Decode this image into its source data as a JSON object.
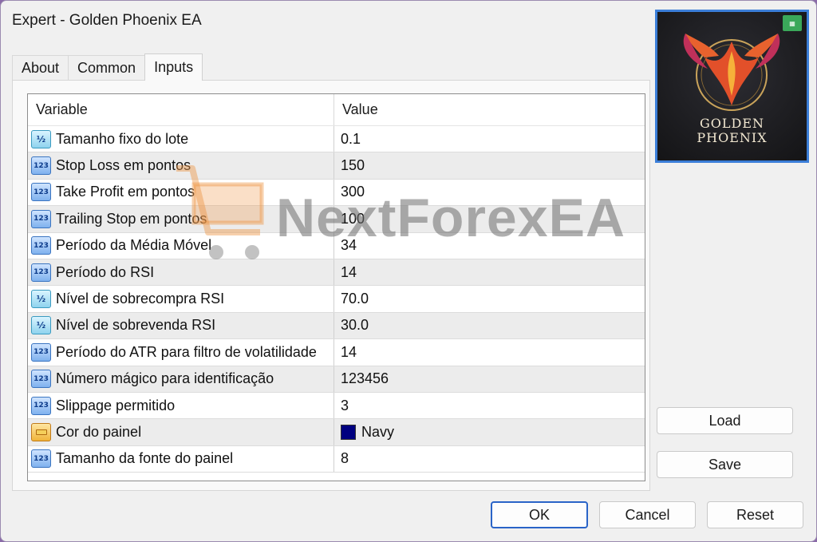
{
  "window": {
    "title": "Expert - Golden Phoenix EA"
  },
  "tabs": [
    {
      "label": "About"
    },
    {
      "label": "Common"
    },
    {
      "label": "Inputs"
    }
  ],
  "table": {
    "columns": [
      "Variable",
      "Value"
    ],
    "rows": [
      {
        "icon": "double-type-icon",
        "variable": "Tamanho fixo do lote",
        "value": "0.1"
      },
      {
        "icon": "integer-type-icon",
        "variable": "Stop Loss em pontos",
        "value": "150"
      },
      {
        "icon": "integer-type-icon",
        "variable": "Take Profit em pontos",
        "value": "300"
      },
      {
        "icon": "integer-type-icon",
        "variable": "Trailing Stop em pontos",
        "value": "100"
      },
      {
        "icon": "integer-type-icon",
        "variable": "Período da Média Móvel",
        "value": "34"
      },
      {
        "icon": "integer-type-icon",
        "variable": "Período do RSI",
        "value": "14"
      },
      {
        "icon": "double-type-icon",
        "variable": "Nível de sobrecompra RSI",
        "value": "70.0"
      },
      {
        "icon": "double-type-icon",
        "variable": "Nível de sobrevenda RSI",
        "value": "30.0"
      },
      {
        "icon": "integer-type-icon",
        "variable": "Período do ATR para filtro de volatilidade",
        "value": "14"
      },
      {
        "icon": "integer-type-icon",
        "variable": "Número mágico para identificação",
        "value": "123456"
      },
      {
        "icon": "integer-type-icon",
        "variable": "Slippage permitido",
        "value": "3"
      },
      {
        "icon": "color-type-icon",
        "variable": "Cor do painel",
        "value": "Navy",
        "swatch_color": "#000080"
      },
      {
        "icon": "integer-type-icon",
        "variable": "Tamanho da fonte do painel",
        "value": "8"
      }
    ]
  },
  "logo": {
    "line1": "GOLDEN",
    "line2": "PHOENIX"
  },
  "side_buttons": {
    "load": "Load",
    "save": "Save"
  },
  "footer_buttons": {
    "ok": "OK",
    "cancel": "Cancel",
    "reset": "Reset"
  },
  "watermark": "NextForexEA",
  "colors": {
    "accent": "#2a64c8",
    "logo_border": "#3b7ed8",
    "swatch": "#000080"
  }
}
